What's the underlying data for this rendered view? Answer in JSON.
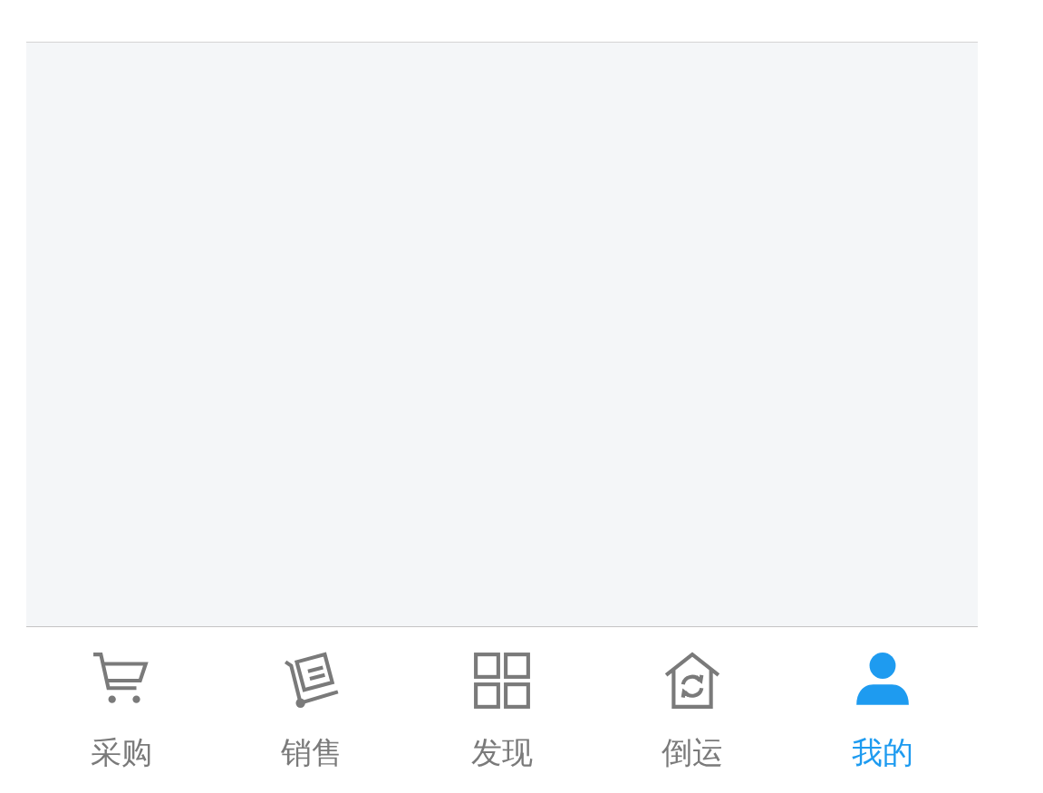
{
  "tabs": [
    {
      "label": "采购",
      "kind": "cart",
      "selected": false
    },
    {
      "label": "销售",
      "kind": "trolley",
      "selected": false
    },
    {
      "label": "发现",
      "kind": "grid",
      "selected": false
    },
    {
      "label": "倒运",
      "kind": "house",
      "selected": false
    },
    {
      "label": "我的",
      "kind": "person",
      "selected": true
    }
  ]
}
